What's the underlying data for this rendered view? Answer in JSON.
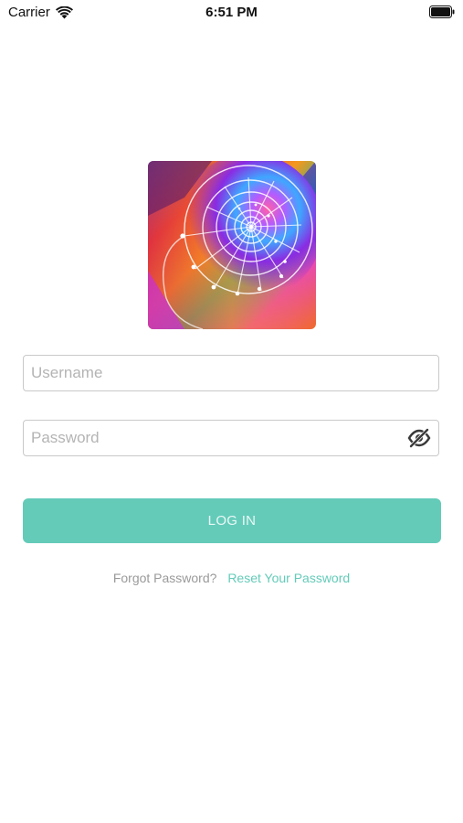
{
  "status_bar": {
    "carrier": "Carrier",
    "time": "6:51 PM",
    "wifi_icon": "wifi-icon",
    "battery_icon": "battery-icon"
  },
  "logo": {
    "icon": "nautilus-shell-logo",
    "colors": [
      "#e8342a",
      "#f29a1e",
      "#2f9cd6",
      "#9b3fd1",
      "#e84ab0",
      "#28b48c"
    ]
  },
  "login_form": {
    "username": {
      "placeholder": "Username",
      "value": ""
    },
    "password": {
      "placeholder": "Password",
      "value": "",
      "toggle_icon": "eye-slash-icon"
    },
    "login_label": "LOG IN",
    "forgot_text": "Forgot Password?",
    "reset_link": "Reset Your Password"
  },
  "colors": {
    "accent": "#64cbb9",
    "button_text": "#eaf8f5",
    "placeholder": "#b4b4b4",
    "border": "#c9c9c9",
    "muted_text": "#9a9a9a"
  }
}
